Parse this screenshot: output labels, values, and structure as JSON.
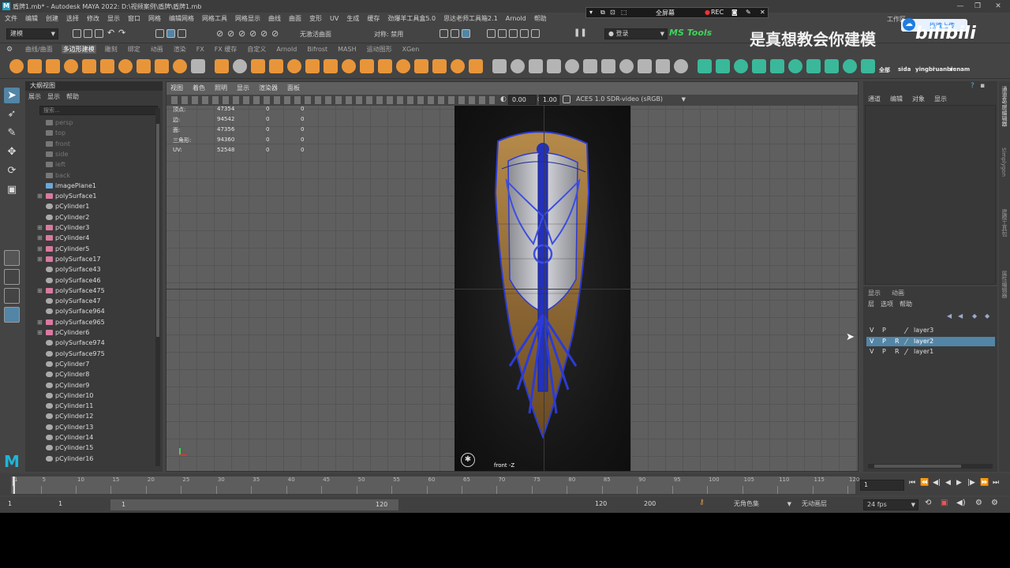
{
  "window": {
    "title": "盾牌1.mb* - Autodesk MAYA 2022: D:\\视频案例\\盾牌\\盾牌1.mb"
  },
  "menubar": [
    "文件",
    "编辑",
    "创建",
    "选择",
    "修改",
    "显示",
    "窗口",
    "网格",
    "编辑网格",
    "网格工具",
    "网格显示",
    "曲线",
    "曲面",
    "变形",
    "UV",
    "生成",
    "缓存",
    "劲爆羊工具盒5.0",
    "思达老师工具箱2.1",
    "Arnold",
    "帮助"
  ],
  "workspace": "工作区",
  "statusline": {
    "mode": "建模",
    "no_live_surface": "无激活曲面",
    "symmetry": "对称: 禁用",
    "login": "登录",
    "ms_tools": "MS Tools"
  },
  "rec_overlay": {
    "fullscreen": "全屏幕",
    "rec": "REC"
  },
  "watermark": {
    "text": "是真想教会你建模",
    "badge": "拖拽上传"
  },
  "shelf_tabs": [
    "曲线/曲面",
    "多边形建模",
    "雕刻",
    "绑定",
    "动画",
    "渲染",
    "FX",
    "FX 缓存",
    "自定义",
    "Arnold",
    "Bifrost",
    "MASH",
    "运动图形",
    "XGen"
  ],
  "shelf_active": 1,
  "shelf_labels": [
    "全部",
    "sida",
    "yingbi",
    "ruanbi",
    "renam"
  ],
  "outliner": {
    "title": "大纲视图",
    "menu": [
      "展示",
      "显示",
      "帮助"
    ],
    "search_placeholder": "搜索...",
    "items": [
      {
        "label": "persp",
        "exp": "",
        "dim": true,
        "kind": "cam"
      },
      {
        "label": "top",
        "exp": "",
        "dim": true,
        "kind": "cam"
      },
      {
        "label": "front",
        "exp": "",
        "dim": true,
        "kind": "cam"
      },
      {
        "label": "side",
        "exp": "",
        "dim": true,
        "kind": "cam"
      },
      {
        "label": "left",
        "exp": "",
        "dim": true,
        "kind": "cam"
      },
      {
        "label": "back",
        "exp": "",
        "dim": true,
        "kind": "cam"
      },
      {
        "label": "imagePlane1",
        "exp": "",
        "dim": false,
        "kind": "img"
      },
      {
        "label": "polySurface1",
        "exp": "⊞",
        "dim": false,
        "kind": "grp"
      },
      {
        "label": "pCylinder1",
        "exp": "",
        "dim": false,
        "kind": "mesh"
      },
      {
        "label": "pCylinder2",
        "exp": "",
        "dim": false,
        "kind": "mesh"
      },
      {
        "label": "pCylinder3",
        "exp": "⊞",
        "dim": false,
        "kind": "grp"
      },
      {
        "label": "pCylinder4",
        "exp": "⊞",
        "dim": false,
        "kind": "grp"
      },
      {
        "label": "pCylinder5",
        "exp": "⊞",
        "dim": false,
        "kind": "grp"
      },
      {
        "label": "polySurface17",
        "exp": "⊞",
        "dim": false,
        "kind": "grp"
      },
      {
        "label": "polySurface43",
        "exp": "",
        "dim": false,
        "kind": "mesh"
      },
      {
        "label": "polySurface46",
        "exp": "",
        "dim": false,
        "kind": "mesh"
      },
      {
        "label": "polySurface475",
        "exp": "⊞",
        "dim": false,
        "kind": "grp"
      },
      {
        "label": "polySurface47",
        "exp": "",
        "dim": false,
        "kind": "mesh"
      },
      {
        "label": "polySurface964",
        "exp": "",
        "dim": false,
        "kind": "mesh"
      },
      {
        "label": "polySurface965",
        "exp": "⊞",
        "dim": false,
        "kind": "grp"
      },
      {
        "label": "pCylinder6",
        "exp": "⊞",
        "dim": false,
        "kind": "grp"
      },
      {
        "label": "polySurface974",
        "exp": "",
        "dim": false,
        "kind": "mesh"
      },
      {
        "label": "polySurface975",
        "exp": "",
        "dim": false,
        "kind": "mesh"
      },
      {
        "label": "pCylinder7",
        "exp": "",
        "dim": false,
        "kind": "mesh"
      },
      {
        "label": "pCylinder8",
        "exp": "",
        "dim": false,
        "kind": "mesh"
      },
      {
        "label": "pCylinder9",
        "exp": "",
        "dim": false,
        "kind": "mesh"
      },
      {
        "label": "pCylinder10",
        "exp": "",
        "dim": false,
        "kind": "mesh"
      },
      {
        "label": "pCylinder11",
        "exp": "",
        "dim": false,
        "kind": "mesh"
      },
      {
        "label": "pCylinder12",
        "exp": "",
        "dim": false,
        "kind": "mesh"
      },
      {
        "label": "pCylinder13",
        "exp": "",
        "dim": false,
        "kind": "mesh"
      },
      {
        "label": "pCylinder14",
        "exp": "",
        "dim": false,
        "kind": "mesh"
      },
      {
        "label": "pCylinder15",
        "exp": "",
        "dim": false,
        "kind": "mesh"
      },
      {
        "label": "pCylinder16",
        "exp": "",
        "dim": false,
        "kind": "mesh"
      }
    ]
  },
  "viewport": {
    "menu": [
      "视图",
      "着色",
      "照明",
      "显示",
      "渲染器",
      "面板"
    ],
    "exposure": "0.00",
    "gamma": "1.00",
    "colorspace": "ACES 1.0 SDR-video (sRGB)",
    "camera_label": "front -Z",
    "stats": [
      {
        "label": "顶点:",
        "v": "47354",
        "a": "0",
        "b": "0"
      },
      {
        "label": "边:",
        "v": "94542",
        "a": "0",
        "b": "0"
      },
      {
        "label": "面:",
        "v": "47356",
        "a": "0",
        "b": "0"
      },
      {
        "label": "三角形:",
        "v": "94360",
        "a": "0",
        "b": "0"
      },
      {
        "label": "UV:",
        "v": "52548",
        "a": "0",
        "b": "0"
      }
    ]
  },
  "channelbox": {
    "menu": [
      "通道",
      "编辑",
      "对象",
      "显示"
    ]
  },
  "layers": {
    "tabs": [
      "显示",
      "动画"
    ],
    "menu": [
      "层",
      "选项",
      "帮助"
    ],
    "rows": [
      {
        "v": "V",
        "p": "P",
        "r": "",
        "name": "layer3",
        "selected": false
      },
      {
        "v": "V",
        "p": "P",
        "r": "R",
        "name": "layer2",
        "selected": true
      },
      {
        "v": "V",
        "p": "P",
        "r": "R",
        "name": "layer1",
        "selected": false
      }
    ]
  },
  "side_tabs": [
    "通道盒/层编辑器",
    "Simplygon",
    "建模工具包",
    "属性编辑器"
  ],
  "timeline": {
    "ticks": [
      "1",
      "5",
      "10",
      "15",
      "20",
      "25",
      "30",
      "35",
      "40",
      "45",
      "50",
      "55",
      "60",
      "65",
      "70",
      "75",
      "80",
      "85",
      "90",
      "95",
      "100",
      "105",
      "110",
      "115",
      "120"
    ],
    "current": "1"
  },
  "range": {
    "start": "1",
    "inner_start": "1",
    "slider_start": "1",
    "slider_end": "120",
    "end": "120",
    "max": "200",
    "no_char": "无角色集",
    "no_anim_layer": "无动画层",
    "fps": "24 fps"
  },
  "colors": {
    "accent": "#5285a6",
    "shelf_orange": "#e8953a",
    "shelf_teal": "#3ab89a",
    "shield_blue": "#2c3bd6"
  }
}
